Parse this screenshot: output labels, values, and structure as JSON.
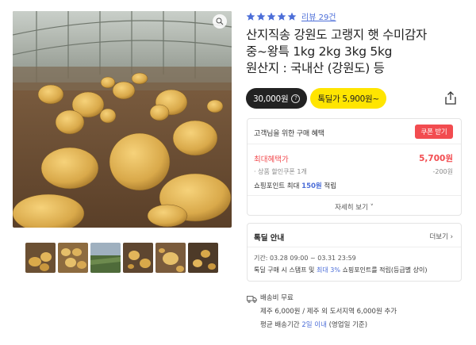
{
  "gallery": {
    "zoom_icon": "magnify-icon",
    "thumbnail_count": 6
  },
  "rating": {
    "stars": 5,
    "review_link": "리뷰 29건",
    "star_color": "#4c6ed8"
  },
  "product": {
    "title_line1": "산지직송 강원도 고랭지 햇 수미감자",
    "title_line2": "중~왕특 1kg 2kg 3kg 5kg",
    "title_line3": "원산지 : 국내산 (강원도) 등"
  },
  "price": {
    "original": "30,000원",
    "deal": "톡딜가 5,900원~",
    "deal_color": "#ffe500"
  },
  "benefit": {
    "heading": "고객님을 위한 구매 혜택",
    "coupon_button": "쿠폰 받기",
    "best_label": "최대혜택가",
    "best_price": "5,700원",
    "coupon_line": "· 상품 할인쿠폰 1개",
    "coupon_amount": "-200원",
    "points_prefix": "쇼핑포인트 최대 ",
    "points_value": "150원",
    "points_suffix": " 적립",
    "more_detail": "자세히 보기 ˅",
    "accent_red": "#f24c50"
  },
  "deal_info": {
    "heading": "톡딜 안내",
    "more": "더보기 ›",
    "period": "기간: 03.28 09:00 ~ 03.31 23:59",
    "desc_prefix": "톡딜 구매 시 스탬프 및 ",
    "desc_highlight": "최대 3%",
    "desc_suffix": " 쇼핑포인트를 적립(등급별 상이)"
  },
  "shipping": {
    "fee": "배송비 무료",
    "extra_prefix": "제주 6,000원 / 제주 외 도서지역 6,000원 추가",
    "eta_prefix": "평균 배송기간 ",
    "eta_value": "2일 이내",
    "eta_suffix": " (영업일 기준)"
  }
}
